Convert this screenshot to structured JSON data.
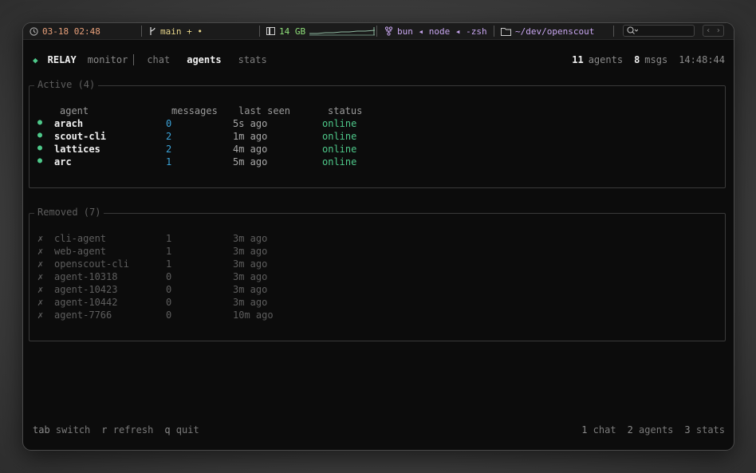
{
  "statusbar": {
    "clock": "03-18 02:48",
    "git": "main + •",
    "memory": "14 GB",
    "process": "bun ◂ node ◂ -zsh",
    "path": "~/dev/openscout",
    "icons": [
      "clock-icon",
      "git-branch-icon",
      "memory-icon",
      "process-icon",
      "folder-icon",
      "search-icon",
      "chevron-left-icon",
      "chevron-right-icon"
    ]
  },
  "header": {
    "app": "RELAY",
    "mode": "monitor",
    "tabs": [
      "chat",
      "agents",
      "stats"
    ],
    "active_tab": "agents",
    "agents_count": "11",
    "agents_label": "agents",
    "msgs_count": "8",
    "msgs_label": "msgs",
    "time": "14:48:44"
  },
  "active": {
    "title": "Active (4)",
    "columns": [
      "agent",
      "messages",
      "last seen",
      "status"
    ],
    "rows": [
      {
        "name": "arach",
        "messages": "0",
        "last_seen": "5s ago",
        "status": "online"
      },
      {
        "name": "scout-cli",
        "messages": "2",
        "last_seen": "1m ago",
        "status": "online"
      },
      {
        "name": "lattices",
        "messages": "2",
        "last_seen": "4m ago",
        "status": "online"
      },
      {
        "name": "arc",
        "messages": "1",
        "last_seen": "5m ago",
        "status": "online"
      }
    ]
  },
  "removed": {
    "title": "Removed (7)",
    "marker": "✗",
    "rows": [
      {
        "name": "cli-agent",
        "messages": "1",
        "last_seen": "3m ago"
      },
      {
        "name": "web-agent",
        "messages": "1",
        "last_seen": "3m ago"
      },
      {
        "name": "openscout-cli",
        "messages": "1",
        "last_seen": "3m ago"
      },
      {
        "name": "agent-10318",
        "messages": "0",
        "last_seen": "3m ago"
      },
      {
        "name": "agent-10423",
        "messages": "0",
        "last_seen": "3m ago"
      },
      {
        "name": "agent-10442",
        "messages": "0",
        "last_seen": "3m ago"
      },
      {
        "name": "agent-7766",
        "messages": "0",
        "last_seen": "10m ago"
      }
    ]
  },
  "footer": {
    "left": [
      {
        "key": "tab",
        "action": "switch"
      },
      {
        "key": "r",
        "action": "refresh"
      },
      {
        "key": "q",
        "action": "quit"
      }
    ],
    "right": [
      {
        "key": "1",
        "action": "chat"
      },
      {
        "key": "2",
        "action": "agents"
      },
      {
        "key": "3",
        "action": "stats"
      }
    ]
  },
  "colors": {
    "online": "#4ec98a",
    "messages": "#3ba3d8",
    "accent": "#4ec98a"
  }
}
